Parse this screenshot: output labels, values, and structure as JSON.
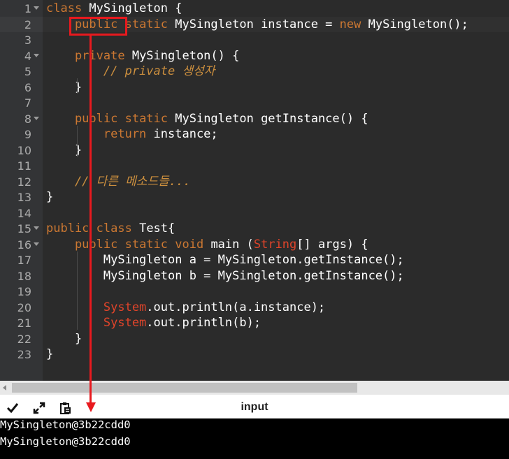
{
  "editor": {
    "lines": [
      {
        "num": "1",
        "fold": true,
        "tokens": [
          {
            "t": "class",
            "c": "kw"
          },
          {
            "t": " MySingleton {",
            "c": ""
          }
        ]
      },
      {
        "num": "2",
        "fold": false,
        "active": true,
        "tokens": [
          {
            "t": "    public",
            "c": "kw"
          },
          {
            "t": " static",
            "c": "kw"
          },
          {
            "t": " MySingleton instance = ",
            "c": ""
          },
          {
            "t": "new",
            "c": "kw"
          },
          {
            "t": " MySingleton();",
            "c": ""
          }
        ]
      },
      {
        "num": "3",
        "fold": false,
        "tokens": []
      },
      {
        "num": "4",
        "fold": true,
        "tokens": [
          {
            "t": "    private",
            "c": "kw"
          },
          {
            "t": " MySingleton() {",
            "c": ""
          }
        ]
      },
      {
        "num": "5",
        "fold": false,
        "tokens": [
          {
            "t": "        // private 생성자",
            "c": "cmt"
          }
        ]
      },
      {
        "num": "6",
        "fold": false,
        "tokens": [
          {
            "t": "    }",
            "c": ""
          }
        ]
      },
      {
        "num": "7",
        "fold": false,
        "tokens": []
      },
      {
        "num": "8",
        "fold": true,
        "tokens": [
          {
            "t": "    public",
            "c": "kw"
          },
          {
            "t": " static",
            "c": "kw"
          },
          {
            "t": " MySingleton getInstance() {",
            "c": ""
          }
        ]
      },
      {
        "num": "9",
        "fold": false,
        "tokens": [
          {
            "t": "        return",
            "c": "kw"
          },
          {
            "t": " instance;",
            "c": ""
          }
        ]
      },
      {
        "num": "10",
        "fold": false,
        "tokens": [
          {
            "t": "    }",
            "c": ""
          }
        ]
      },
      {
        "num": "11",
        "fold": false,
        "tokens": []
      },
      {
        "num": "12",
        "fold": false,
        "tokens": [
          {
            "t": "    // 다른 메소드들...",
            "c": "cmt"
          }
        ]
      },
      {
        "num": "13",
        "fold": false,
        "tokens": [
          {
            "t": "}",
            "c": ""
          }
        ]
      },
      {
        "num": "14",
        "fold": false,
        "tokens": []
      },
      {
        "num": "15",
        "fold": true,
        "tokens": [
          {
            "t": "public",
            "c": "kw"
          },
          {
            "t": " class",
            "c": "kw"
          },
          {
            "t": " Test{",
            "c": ""
          }
        ]
      },
      {
        "num": "16",
        "fold": true,
        "tokens": [
          {
            "t": "    public",
            "c": "kw"
          },
          {
            "t": " static",
            "c": "kw"
          },
          {
            "t": " void",
            "c": "kw"
          },
          {
            "t": " main (",
            "c": ""
          },
          {
            "t": "String",
            "c": "red"
          },
          {
            "t": "[] args) {",
            "c": ""
          }
        ]
      },
      {
        "num": "17",
        "fold": false,
        "tokens": [
          {
            "t": "        MySingleton a = MySingleton.getInstance();",
            "c": ""
          }
        ]
      },
      {
        "num": "18",
        "fold": false,
        "tokens": [
          {
            "t": "        MySingleton b = MySingleton.getInstance();",
            "c": ""
          }
        ]
      },
      {
        "num": "19",
        "fold": false,
        "tokens": []
      },
      {
        "num": "20",
        "fold": false,
        "tokens": [
          {
            "t": "        System",
            "c": "red"
          },
          {
            "t": ".out.println(a.instance);",
            "c": ""
          }
        ]
      },
      {
        "num": "21",
        "fold": false,
        "tokens": [
          {
            "t": "        System",
            "c": "red"
          },
          {
            "t": ".out.println(b);",
            "c": ""
          }
        ]
      },
      {
        "num": "22",
        "fold": false,
        "tokens": [
          {
            "t": "    }",
            "c": ""
          }
        ]
      },
      {
        "num": "23",
        "fold": false,
        "tokens": [
          {
            "t": "}",
            "c": ""
          }
        ]
      }
    ]
  },
  "toolbar": {
    "title": "input",
    "icons": [
      "check-icon",
      "expand-icon",
      "paste-icon"
    ]
  },
  "output": {
    "lines": [
      "MySingleton@3b22cdd0",
      "MySingleton@3b22cdd0"
    ]
  },
  "colors": {
    "background": "#2b2b2b",
    "keyword": "#cc7832",
    "comment": "#cc8f3e",
    "type": "#e0442a",
    "annotation": "#e8191e"
  }
}
